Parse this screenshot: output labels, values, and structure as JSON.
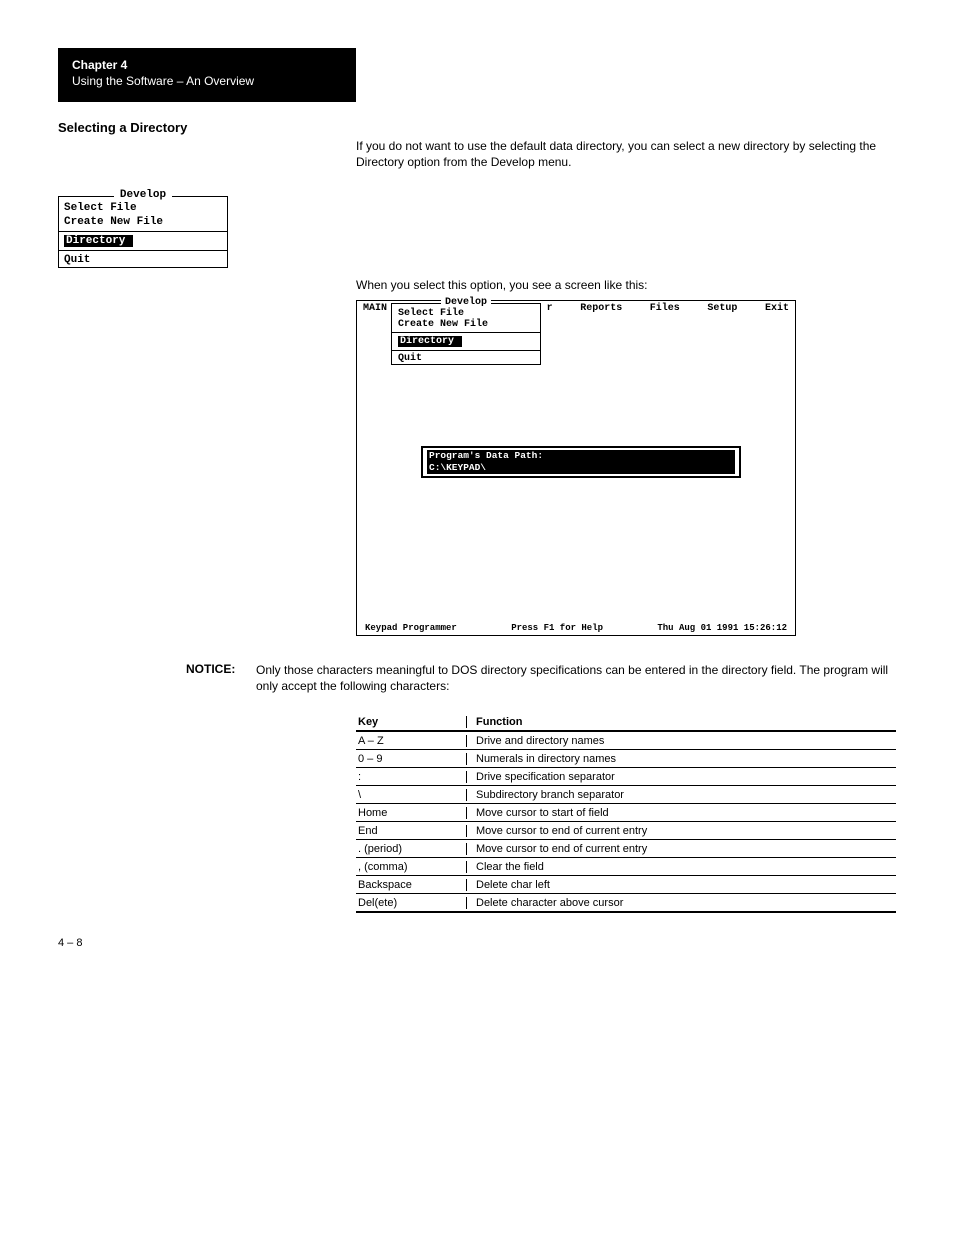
{
  "chapter": {
    "label": "Chapter 4",
    "title": "Using the Software – An Overview"
  },
  "section": {
    "heading": "Selecting a Directory",
    "intro": "If you do not want to use the default data directory, you can select a new directory by selecting the Directory option from the Develop menu."
  },
  "small_menu": {
    "title": "Develop",
    "items": [
      "Select File",
      "Create New File"
    ],
    "highlight": "Directory",
    "footer": "Quit"
  },
  "when_select": "When you select this option, you see a screen like this:",
  "screen": {
    "menubar": [
      "MAIN",
      "r",
      "Reports",
      "Files",
      "Setup",
      "Exit"
    ],
    "dropdown_title": "Develop",
    "dropdown_items": [
      "Select File",
      "Create New File"
    ],
    "dropdown_highlight": "Directory",
    "dropdown_footer": "Quit",
    "path_label": "Program's Data Path:",
    "path_value": "C:\\KEYPAD\\",
    "status_left": "Keypad Programmer",
    "status_mid": "Press F1 for Help",
    "status_right": "Thu Aug 01 1991 15:26:12"
  },
  "notice": {
    "label": "NOTICE:",
    "text": "Only those characters meaningful to DOS directory specifications can be entered in the directory field.  The program will only accept the following characters:"
  },
  "chart_data": {
    "type": "table",
    "columns": [
      "Key",
      "Function"
    ],
    "rows": [
      [
        "A – Z",
        "Drive and directory names"
      ],
      [
        "0 – 9",
        "Numerals in directory names"
      ],
      [
        ":",
        "Drive specification separator"
      ],
      [
        "\\",
        "Subdirectory branch separator"
      ],
      [
        "Home",
        "Move cursor to start of field"
      ],
      [
        "End",
        "Move cursor to end of current entry"
      ],
      [
        ". (period)",
        "Move cursor to end of current entry"
      ],
      [
        ", (comma)",
        "Clear the field"
      ],
      [
        "Backspace",
        "Delete char left"
      ],
      [
        "Del(ete)",
        "Delete character above cursor"
      ]
    ]
  },
  "page": {
    "number": "4 – 8"
  }
}
